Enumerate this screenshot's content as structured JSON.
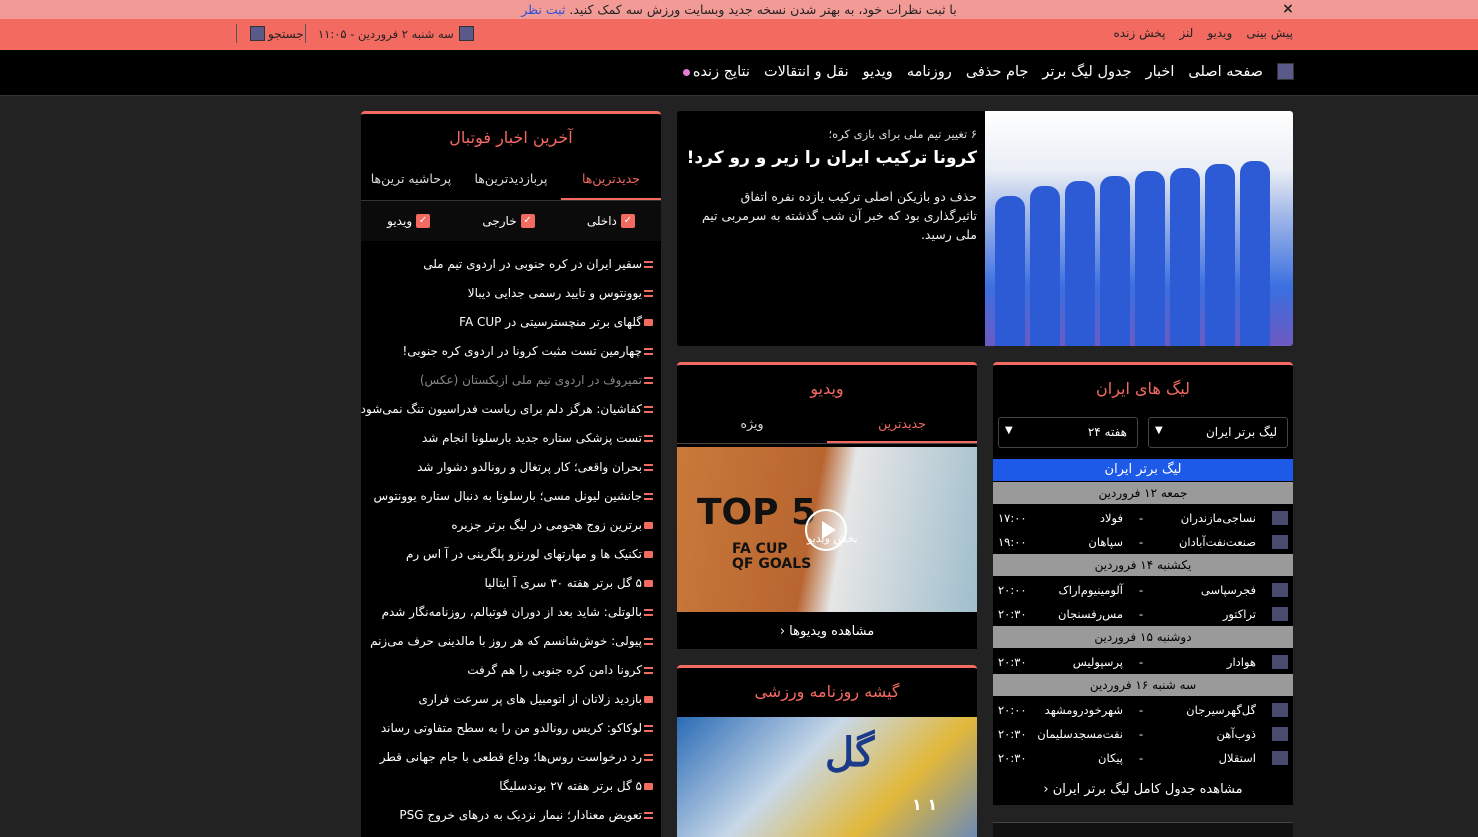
{
  "notification": {
    "text": "با ثبت نظرات خود، به بهتر شدن نسخه جدید وبسایت ورزش سه کمک کنید.",
    "link": "ثبت نظر",
    "close": "×"
  },
  "topbar": {
    "links": [
      "پیش بینی",
      "ویدیو",
      "لنز",
      "پخش زنده"
    ],
    "date": "سه شنبه ۲ فروردین - ۱۱:۰۵",
    "search": "جستجو"
  },
  "nav": {
    "items": [
      "صفحه اصلی",
      "اخبار",
      "جدول لیگ برتر",
      "جام حذفی",
      "روزنامه",
      "ویدیو",
      "نقل و انتقالات",
      "نتایج زنده"
    ]
  },
  "hero": {
    "kicker": "۶ تغییر تیم ملی برای بازی کره؛",
    "title": "کرونا ترکیب ایران را زیر و رو کرد!",
    "desc": "حذف دو بازیکن اصلی ترکیب یازده نفره اتفاق تاثیرگذاری بود که خبر آن شب گذشته به سرمربی تیم ملی رسید."
  },
  "news": {
    "title": "آخرین اخبار فوتبال",
    "tabs": [
      "جدیدترین‌ها",
      "پربازدیدترین‌ها",
      "پرحاشیه ترین‌ها"
    ],
    "filters": [
      "داخلی",
      "خارجی",
      "ویدیو"
    ],
    "items": [
      {
        "text": "سفیر ایران در کره جنوبی در اردوی تیم ملی",
        "type": "t"
      },
      {
        "text": "یوونتوس و تایید رسمی جدایی دیبالا",
        "type": "t"
      },
      {
        "text": "گلهای برتر منچسترسیتی در FA CUP",
        "type": "v"
      },
      {
        "text": "چهارمین تست مثبت کرونا در اردوی کره جنوبی!",
        "type": "t"
      },
      {
        "text": "تمیروف در اردوی تیم ملی ازبکستان (عکس)",
        "type": "t"
      },
      {
        "text": "کفاشیان: هرگز دلم برای ریاست فدراسیون تنگ نمی‌شود",
        "type": "t"
      },
      {
        "text": "تست پزشکی ستاره جدید بارسلونا انجام شد",
        "type": "t"
      },
      {
        "text": "بحران واقعی؛ کار پرتغال و رونالدو دشوار شد",
        "type": "t"
      },
      {
        "text": "جانشین لیونل مسی؛ بارسلونا به دنبال ستاره یوونتوس",
        "type": "t"
      },
      {
        "text": "برترین زوج هجومی در لیگ برتر جزیره",
        "type": "v"
      },
      {
        "text": "تکنیک ها و مهارتهای لورنزو پلگرینی در آ اس رم",
        "type": "v"
      },
      {
        "text": "۵ گل برتر هفته ۳۰ سری آ ایتالیا",
        "type": "v"
      },
      {
        "text": "بالوتلی: شاید بعد از دوران فوتبالم، روزنامه‌نگار شدم",
        "type": "t"
      },
      {
        "text": "پیولی: خوش‌شانسم که هر روز با مالدینی حرف می‌زنم",
        "type": "t"
      },
      {
        "text": "کرونا دامن کره جنوبی را هم گرفت",
        "type": "t"
      },
      {
        "text": "بازدید زلاتان از اتومبیل های پر سرعت فراری",
        "type": "v"
      },
      {
        "text": "لوکاکو: کریس رونالدو من را به سطح متفاوتی رساند",
        "type": "t"
      },
      {
        "text": "رد درخواست روس‌ها؛ وداع قطعی با جام جهانی قطر",
        "type": "t"
      },
      {
        "text": "۵ گل برتر هفته ۲۷ بوندسلیگا",
        "type": "v"
      },
      {
        "text": "تعویض معنادار؛ نیمار نزدیک به درهای خروج PSG",
        "type": "t"
      }
    ]
  },
  "league": {
    "title": "لیگ های ایران",
    "select_league": "لیگ برتر ایران",
    "select_week": "هفته ۲۴",
    "league_name": "لیگ برتر ایران",
    "days": [
      {
        "label": "جمعه ۱۲ فروردین",
        "matches": [
          {
            "home": "نساجی‌مازندران",
            "away": "فولاد",
            "time": "۱۷:۰۰"
          },
          {
            "home": "صنعت‌نفت‌آبادان",
            "away": "سپاهان",
            "time": "۱۹:۰۰"
          }
        ]
      },
      {
        "label": "یکشنبه ۱۴ فروردین",
        "matches": [
          {
            "home": "فجرسپاسی",
            "away": "آلومینیوم‌اراک",
            "time": "۲۰:۰۰"
          },
          {
            "home": "تراکتور",
            "away": "مس‌رفسنجان",
            "time": "۲۰:۳۰"
          }
        ]
      },
      {
        "label": "دوشنبه ۱۵ فروردین",
        "matches": [
          {
            "home": "هوادار",
            "away": "پرسپولیس",
            "time": "۲۰:۳۰"
          }
        ]
      },
      {
        "label": "سه شنبه ۱۶ فروردین",
        "matches": [
          {
            "home": "گل‌گهرسیرجان",
            "away": "شهرخودرومشهد",
            "time": "۲۰:۰۰"
          },
          {
            "home": "ذوب‌آهن",
            "away": "نفت‌مسجدسلیمان",
            "time": "۲۰:۳۰"
          },
          {
            "home": "استقلال",
            "away": "پیکان",
            "time": "۲۰:۳۰"
          }
        ]
      }
    ],
    "more": "مشاهده جدول کامل لیگ برتر ایران"
  },
  "video": {
    "title": "ویدیو",
    "tabs": [
      "جدیدترین",
      "ویژه"
    ],
    "thumb_top": "TOP 5",
    "thumb_sub1": "FA CUP",
    "thumb_sub2": "QF GOALS",
    "play_label": "پخش ویدیو",
    "more": "مشاهده ویدیوها"
  },
  "paper": {
    "title": "گیشه روزنامه ورزشی",
    "brand": "گل",
    "score": "۱ ۱"
  },
  "colors": {
    "accent": "#f36a61",
    "league_bar": "#1e5ae8",
    "day_bar": "#9a9a9a"
  }
}
